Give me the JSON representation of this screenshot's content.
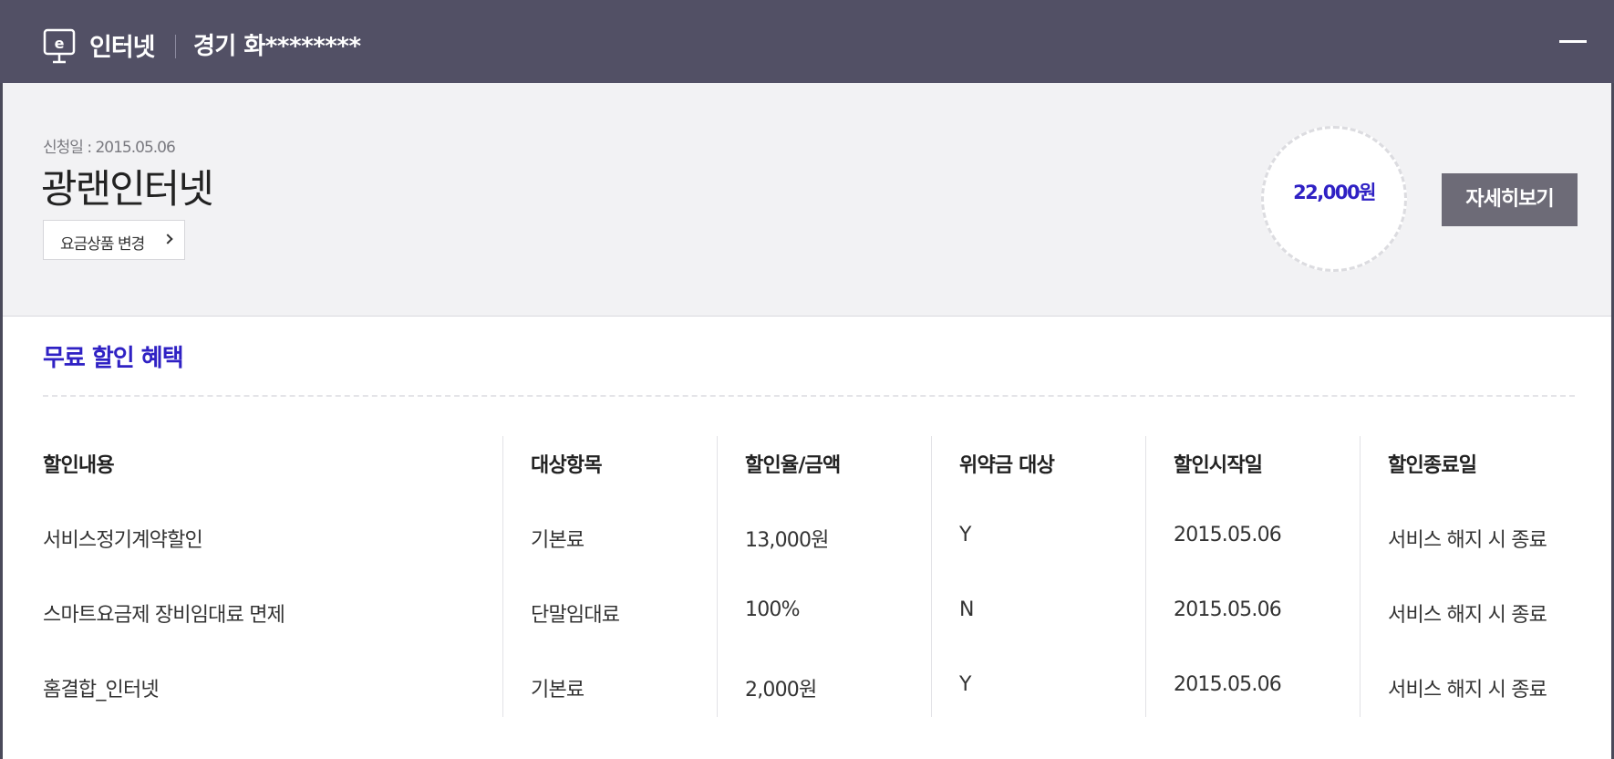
{
  "header": {
    "icon": "monitor-e-icon",
    "title": "인터넷",
    "subtitle": "경기 화********",
    "minimize_icon": "minus-icon"
  },
  "summary": {
    "apply_date": "신청일 : 2015.05.06",
    "plan_name": "광랜인터넷",
    "change_plan_label": "요금상품 변경",
    "price": "22,000원",
    "detail_label": "자세히보기"
  },
  "discount": {
    "title": "무료 할인 혜택",
    "columns": [
      "할인내용",
      "대상항목",
      "할인율/금액",
      "위약금 대상",
      "할인시작일",
      "할인종료일"
    ],
    "rows": [
      [
        "서비스정기계약할인",
        "기본료",
        "13,000원",
        "Y",
        "2015.05.06",
        "서비스 해지 시 종료"
      ],
      [
        "스마트요금제 장비임대료 면제",
        "단말임대료",
        "100%",
        "N",
        "2015.05.06",
        "서비스 해지 시 종료"
      ],
      [
        "홈결합_인터넷",
        "기본료",
        "2,000원",
        "Y",
        "2015.05.06",
        "서비스 해지 시 종료"
      ]
    ]
  },
  "colors": {
    "header_bg": "#525065",
    "accent": "#2f21c4",
    "summary_bg": "#f2f2f4",
    "button_bg": "#6d6b77"
  }
}
